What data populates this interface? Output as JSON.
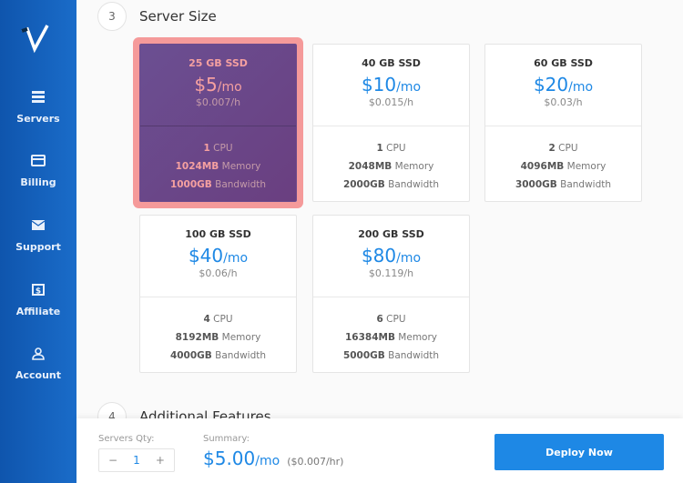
{
  "sidebar": {
    "items": [
      {
        "label": "Servers",
        "icon": "servers-icon"
      },
      {
        "label": "Billing",
        "icon": "credit-card-icon"
      },
      {
        "label": "Support",
        "icon": "envelope-icon"
      },
      {
        "label": "Affiliate",
        "icon": "dollar-icon"
      },
      {
        "label": "Account",
        "icon": "user-icon"
      }
    ]
  },
  "sections": [
    {
      "number": "3",
      "title": "Server Size"
    },
    {
      "number": "4",
      "title": "Additional Features"
    }
  ],
  "plans": [
    {
      "ssd": "25 GB SSD",
      "price": "$5",
      "per": "/mo",
      "hourly": "$0.007/h",
      "cpu": "1",
      "cpu_label": " CPU",
      "memory": "1024MB",
      "memory_label": " Memory",
      "bandwidth": "1000GB",
      "bandwidth_label": " Bandwidth",
      "selected": true
    },
    {
      "ssd": "40 GB SSD",
      "price": "$10",
      "per": "/mo",
      "hourly": "$0.015/h",
      "cpu": "1",
      "cpu_label": " CPU",
      "memory": "2048MB",
      "memory_label": " Memory",
      "bandwidth": "2000GB",
      "bandwidth_label": " Bandwidth"
    },
    {
      "ssd": "60 GB SSD",
      "price": "$20",
      "per": "/mo",
      "hourly": "$0.03/h",
      "cpu": "2",
      "cpu_label": " CPU",
      "memory": "4096MB",
      "memory_label": " Memory",
      "bandwidth": "3000GB",
      "bandwidth_label": " Bandwidth"
    },
    {
      "ssd": "100 GB SSD",
      "price": "$40",
      "per": "/mo",
      "hourly": "$0.06/h",
      "cpu": "4",
      "cpu_label": " CPU",
      "memory": "8192MB",
      "memory_label": " Memory",
      "bandwidth": "4000GB",
      "bandwidth_label": " Bandwidth"
    },
    {
      "ssd": "200 GB SSD",
      "price": "$80",
      "per": "/mo",
      "hourly": "$0.119/h",
      "cpu": "6",
      "cpu_label": " CPU",
      "memory": "16384MB",
      "memory_label": " Memory",
      "bandwidth": "5000GB",
      "bandwidth_label": " Bandwidth"
    }
  ],
  "footer": {
    "qty_label": "Servers Qty:",
    "qty_minus": "−",
    "qty_value": "1",
    "qty_plus": "+",
    "summary_label": "Summary:",
    "summary_price": "$5.00",
    "summary_per": "/mo",
    "summary_hourly": "($0.007/hr)",
    "deploy_label": "Deploy Now"
  },
  "colors": {
    "accent": "#1e88e5",
    "selected_card": "#6b4a8c",
    "selected_glow": "#f59a9a",
    "sidebar": "#1565c0"
  }
}
